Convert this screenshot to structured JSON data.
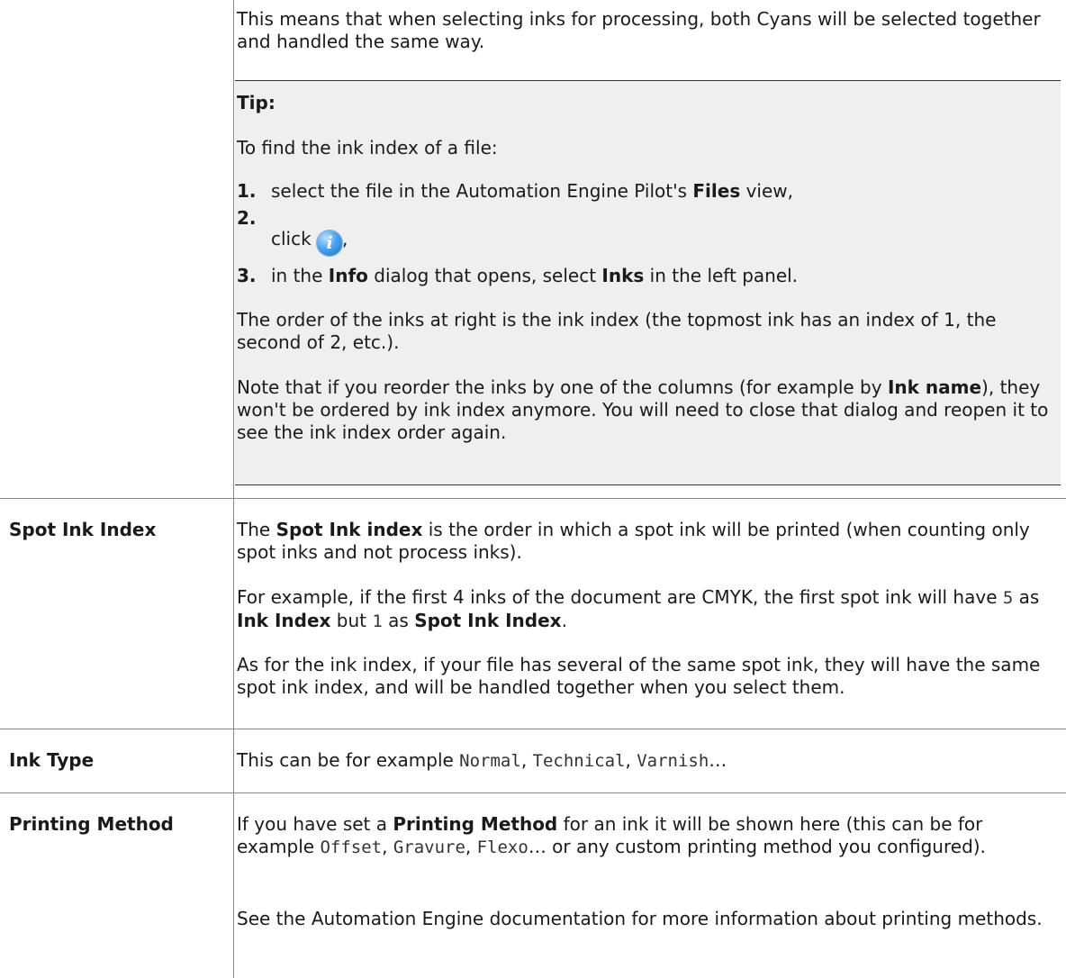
{
  "top_cell": {
    "text": "This means that when selecting inks for processing, both Cyans will be selected together and handled the same way."
  },
  "tip": {
    "title": "Tip:",
    "intro": "To find the ink index of a file:",
    "steps": [
      {
        "num": "1.",
        "pre": "select the file in the Automation Engine Pilot's ",
        "bold": "Files",
        "post": " view,"
      },
      {
        "num": "2.",
        "pre": "click",
        "icon": "info-icon",
        "post": ","
      },
      {
        "num": "3.",
        "pre": "in the ",
        "bold": "Info",
        "mid": " dialog that opens, select ",
        "bold2": "Inks",
        "post": " in the left panel."
      }
    ],
    "para1": "The order of the inks at right is the ink index (the topmost ink has an index of 1, the second of 2, etc.).",
    "para2_pre": "Note that if you reorder the inks by one of the columns (for example by ",
    "para2_bold": "Ink name",
    "para2_post": "), they won't be ordered by ink index anymore. You will need to close that dialog and reopen it to see the ink index order again."
  },
  "rows": {
    "spot_ink_index": {
      "label": "Spot Ink Index",
      "p1_pre": "The ",
      "p1_bold": "Spot Ink index",
      "p1_post": " is the order in which a spot ink will be printed (when counting only spot inks and not process inks).",
      "p2_a": "For example, if the first 4 inks of the document are CMYK, the first spot ink will have ",
      "p2_code1": "5",
      "p2_b": " as ",
      "p2_bold1": "Ink Index",
      "p2_c": " but ",
      "p2_code2": "1",
      "p2_d": " as ",
      "p2_bold2": "Spot Ink Index",
      "p2_e": ".",
      "p3": "As for the ink index, if your file has several of the same spot ink, they will have the same spot ink index, and will be handled together when you select them."
    },
    "ink_type": {
      "label": "Ink Type",
      "pre": "This can be for example ",
      "code1": "Normal",
      "sep1": ", ",
      "code2": "Technical",
      "sep2": ", ",
      "code3": "Varnish",
      "post": "…"
    },
    "printing_method": {
      "label": "Printing Method",
      "p1_pre": "If you have set a ",
      "p1_bold": "Printing Method",
      "p1_mid": " for an ink it will be shown here (this can be for example ",
      "code1": "Offset",
      "sep1": ", ",
      "code2": "Gravure",
      "sep2": ", ",
      "code3": "Flexo",
      "p1_post": "… or any custom printing method you configured).",
      "p2": "See the Automation Engine documentation for more information about printing methods."
    }
  }
}
